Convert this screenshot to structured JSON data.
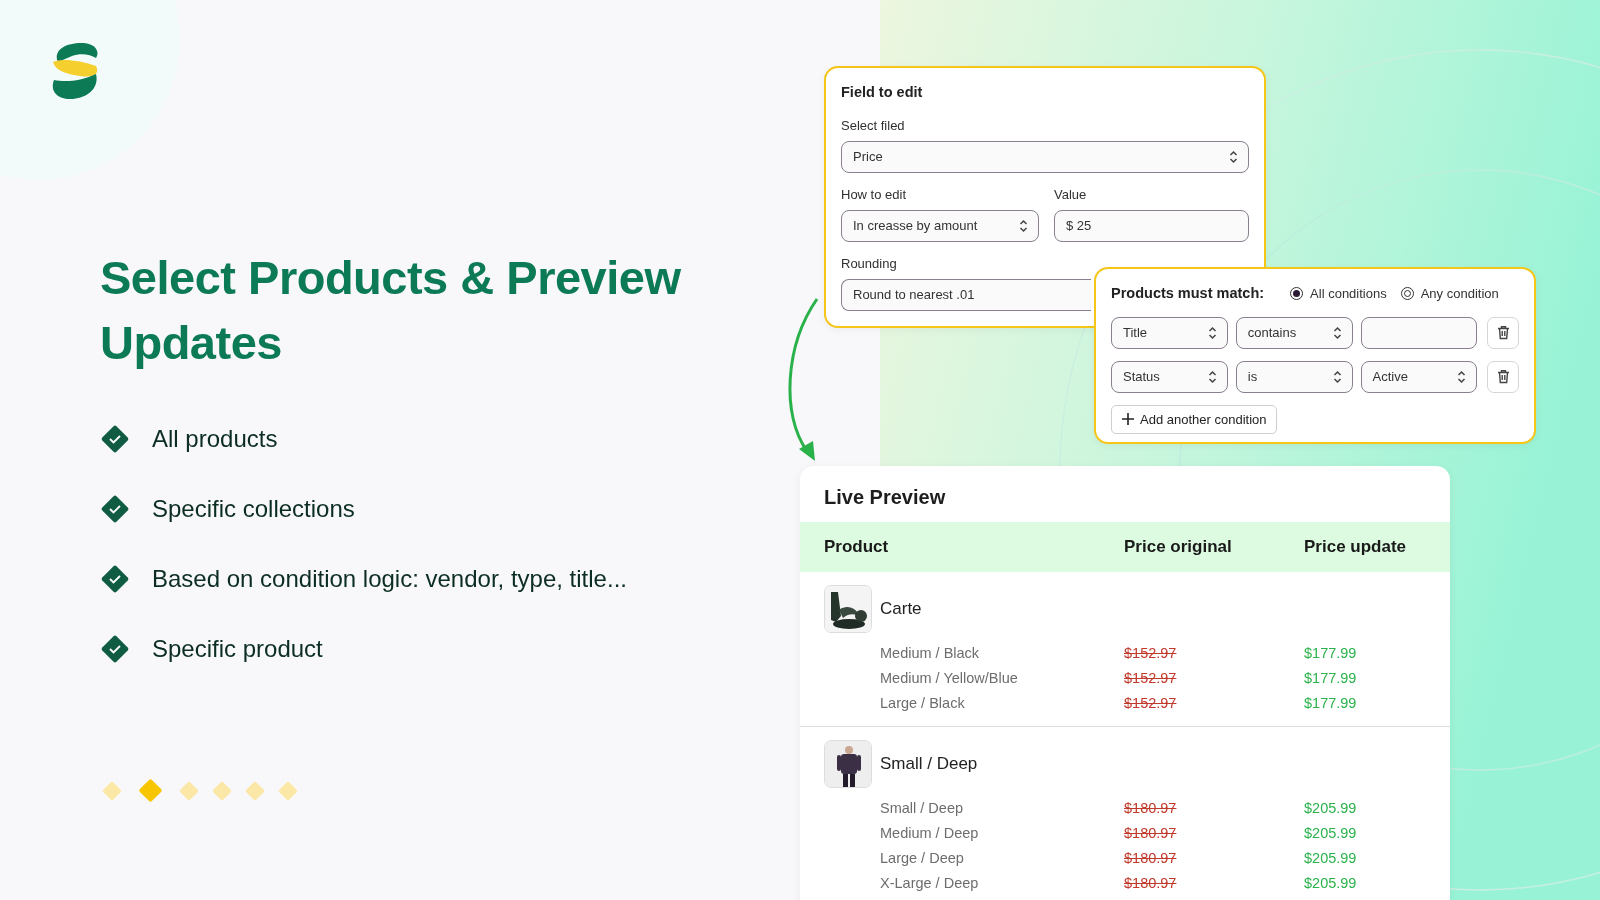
{
  "heading": "Select Products & Preview Updates",
  "features": [
    {
      "label": "All products"
    },
    {
      "label": "Specific collections"
    },
    {
      "label": "Based on condition logic: vendor, type, title..."
    },
    {
      "label": "Specific product"
    }
  ],
  "pager": [
    {
      "selected": false
    },
    {
      "selected": true
    },
    {
      "selected": false
    },
    {
      "selected": false
    },
    {
      "selected": false
    },
    {
      "selected": false
    }
  ],
  "field_panel": {
    "title": "Field to edit",
    "select_field": {
      "label": "Select filed",
      "value": "Price"
    },
    "how_to_edit": {
      "label": "How to edit",
      "value": "In creasse by amount"
    },
    "value": {
      "label": "Value",
      "value": "$ 25"
    },
    "rounding": {
      "label": "Rounding",
      "value": "Round to nearest .01"
    }
  },
  "conditions_panel": {
    "title": "Products must match:",
    "match_options": [
      {
        "label": "All conditions",
        "selected": true
      },
      {
        "label": "Any condition",
        "selected": false
      }
    ],
    "conditions": [
      {
        "field": "Title",
        "operator": "contains",
        "kind": "text"
      },
      {
        "field": "Status",
        "operator": "is",
        "kind": "select",
        "value": "Active"
      }
    ],
    "add_button": "Add another condition"
  },
  "preview": {
    "title": "Live Preview",
    "columns": [
      "Product",
      "Price original",
      "Price update"
    ],
    "products": [
      {
        "name": "Carte",
        "image": {
          "kind": "picture"
        },
        "variants": [
          {
            "name": "Medium / Black",
            "price_original": "$152.97",
            "price_update": "$177.99"
          },
          {
            "name": "Medium / Yellow/Blue",
            "price_original": "$152.97",
            "price_update": "$177.99"
          },
          {
            "name": "Large / Black",
            "price_original": "$152.97",
            "price_update": "$177.99"
          }
        ]
      },
      {
        "name": "Small / Deep",
        "image": {
          "kind": "picture"
        },
        "variants": [
          {
            "name": "Small / Deep",
            "price_original": "$180.97",
            "price_update": "$205.99"
          },
          {
            "name": "Medium / Deep",
            "price_original": "$180.97",
            "price_update": "$205.99"
          },
          {
            "name": "Large / Deep",
            "price_original": "$180.97",
            "price_update": "$205.99"
          },
          {
            "name": "X-Large / Deep",
            "price_original": "$180.97",
            "price_update": "$205.99"
          }
        ]
      }
    ]
  }
}
